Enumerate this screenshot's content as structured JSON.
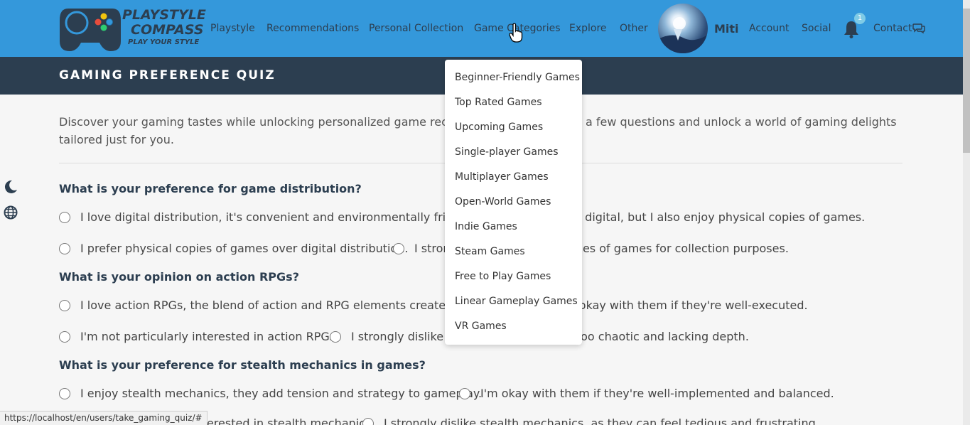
{
  "brand": {
    "line1": "PLAYSTYLE",
    "line2": "COMPASS",
    "tagline": "PLAY YOUR STYLE",
    "colors": {
      "nav_bg": "#3498db",
      "dark": "#2c3e50",
      "badge": "#7fcbe6"
    }
  },
  "nav": {
    "items": [
      "Playstyle",
      "Recommendations",
      "Personal Collection",
      "Game Categories",
      "Explore",
      "Other"
    ],
    "username": "Miti",
    "account": "Account",
    "social": "Social",
    "notification_count": "1",
    "contact": "Contact"
  },
  "header": {
    "title": "GAMING PREFERENCE QUIZ"
  },
  "intro": "Discover your gaming tastes while unlocking personalized game recommendations. Answer a few questions and unlock a world of gaming delights tailored just for you.",
  "questions": [
    {
      "text": "What is your preference for game distribution?",
      "options": [
        "I love digital distribution, it's convenient and environmentally friendly.",
        "I prefer digital, but I also enjoy physical copies of games.",
        "I prefer physical copies of games over digital distribution.",
        "I strongly prefer physical copies of games for collection purposes."
      ]
    },
    {
      "text": "What is your opinion on action RPGs?",
      "options": [
        "I love action RPGs, the blend of action and RPG elements creates engaging gameplay.",
        "I'm okay with them if they're well-executed.",
        "I'm not particularly interested in action RPGs.",
        "I strongly dislike action RPGs, they feel too chaotic and lacking depth."
      ]
    },
    {
      "text": "What is your preference for stealth mechanics in games?",
      "options": [
        "I enjoy stealth mechanics, they add tension and strategy to gameplay.",
        "I'm okay with them if they're well-implemented and balanced.",
        "I'm not particularly interested in stealth mechanics.",
        "I strongly dislike stealth mechanics, as they can feel tedious and frustrating."
      ]
    }
  ],
  "dropdown": {
    "items": [
      "Beginner-Friendly Games",
      "Top Rated Games",
      "Upcoming Games",
      "Single-player Games",
      "Multiplayer Games",
      "Open-World Games",
      "Indie Games",
      "Steam Games",
      "Free to Play Games",
      "Linear Gameplay Games",
      "VR Games"
    ]
  },
  "side_icons": [
    "moon-icon",
    "globe-icon"
  ],
  "status_url": "https://localhost/en/users/take_gaming_quiz/#"
}
